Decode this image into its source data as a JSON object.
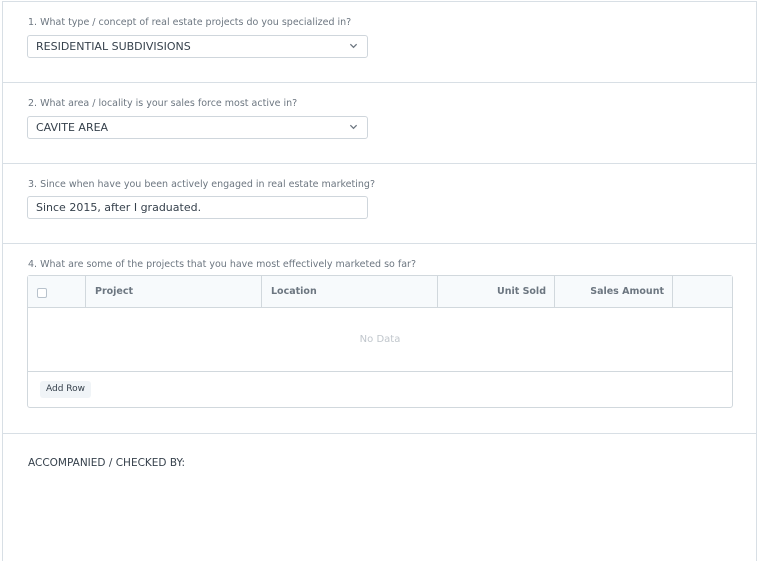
{
  "questions": {
    "q1": {
      "label": "1. What type / concept of real estate projects do you specialized in?",
      "value": "RESIDENTIAL SUBDIVISIONS"
    },
    "q2": {
      "label": "2. What area / locality is your sales force most active in?",
      "value": "CAVITE AREA"
    },
    "q3": {
      "label": "3. Since when have you been actively engaged in real estate marketing?",
      "value": "Since 2015, after I graduated."
    },
    "q4": {
      "label": "4. What are some of the projects that you have most effectively marketed so far?"
    }
  },
  "table": {
    "columns": [
      "Project",
      "Location",
      "Unit Sold",
      "Sales Amount"
    ],
    "empty_text": "No Data",
    "add_row_label": "Add Row"
  },
  "accompanied_label": "ACCOMPANIED / CHECKED BY:",
  "icons": {
    "select": "chevron-down-icon",
    "row_select": "checkbox-icon"
  }
}
